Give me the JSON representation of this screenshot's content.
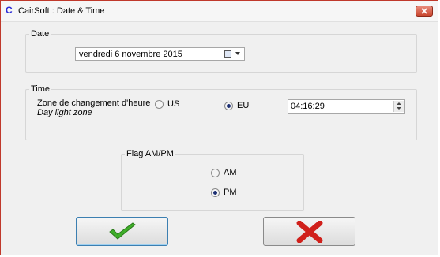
{
  "window": {
    "title": "CairSoft : Date & Time",
    "app_icon_glyph": "C"
  },
  "date_group": {
    "legend": "Date",
    "date_value": "vendredi    6 novembre 2015"
  },
  "time_group": {
    "legend": "Time",
    "zone_label": "Zone de changement d'heure",
    "zone_sublabel": "Day light zone",
    "options": [
      {
        "label": "US",
        "selected": false
      },
      {
        "label": "EU",
        "selected": true
      }
    ],
    "time_value": "04:16:29"
  },
  "ampm_group": {
    "legend": "Flag AM/PM",
    "options": [
      {
        "label": "AM",
        "selected": false
      },
      {
        "label": "PM",
        "selected": true
      }
    ]
  },
  "buttons": {
    "ok_icon": "checkmark-icon",
    "cancel_icon": "x-icon"
  },
  "colors": {
    "checkmark": "#3fae2a",
    "cross": "#d0201b",
    "window_border": "#c0392b",
    "ok_border": "#3c7fb1"
  }
}
